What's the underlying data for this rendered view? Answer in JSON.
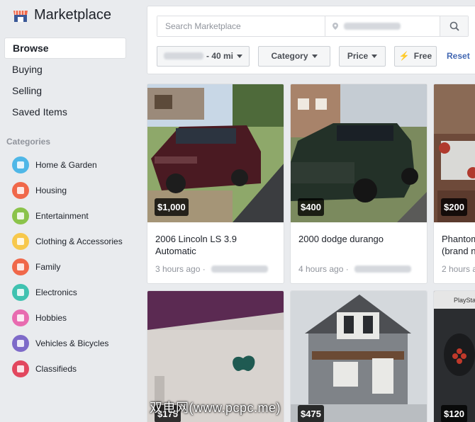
{
  "app": {
    "title": "Marketplace"
  },
  "nav": [
    "Browse",
    "Buying",
    "Selling",
    "Saved Items"
  ],
  "categories_header": "Categories",
  "categories": [
    {
      "label": "Home & Garden",
      "color": "#4fb7e7",
      "icon": "home-icon"
    },
    {
      "label": "Housing",
      "color": "#f0684a",
      "icon": "house-icon"
    },
    {
      "label": "Entertainment",
      "color": "#8bc34a",
      "icon": "gamepad-icon"
    },
    {
      "label": "Clothing & Accessories",
      "color": "#f7c84c",
      "icon": "dress-icon"
    },
    {
      "label": "Family",
      "color": "#f0684a",
      "icon": "heart-icon"
    },
    {
      "label": "Electronics",
      "color": "#3fc2b0",
      "icon": "phone-icon"
    },
    {
      "label": "Hobbies",
      "color": "#e86bb0",
      "icon": "guitar-icon"
    },
    {
      "label": "Vehicles & Bicycles",
      "color": "#7e6ac9",
      "icon": "car-icon"
    },
    {
      "label": "Classifieds",
      "color": "#e2475e",
      "icon": "binoculars-icon"
    }
  ],
  "search": {
    "placeholder": "Search Marketplace"
  },
  "filters": {
    "radius": "- 40 mi",
    "category": "Category",
    "price": "Price",
    "free": "Free",
    "reset": "Reset"
  },
  "listings": [
    {
      "price": "$1,000",
      "title": "2006 Lincoln LS 3.9\nAutomatic",
      "posted": "3 hours ago ·"
    },
    {
      "price": "$400",
      "title": "2000 dodge durango",
      "posted": "4 hours ago ·"
    },
    {
      "price": "$200",
      "title": "Phantom\n(brand n",
      "posted": "2 hours a"
    },
    {
      "price": "$175",
      "title": "",
      "posted": ""
    },
    {
      "price": "$475",
      "title": "",
      "posted": ""
    },
    {
      "price": "$120",
      "title": "",
      "posted": ""
    }
  ],
  "watermark": "双电网(www.pcpc.me)",
  "colors": {
    "accent": "#4267b2",
    "background": "#e9ebee"
  }
}
